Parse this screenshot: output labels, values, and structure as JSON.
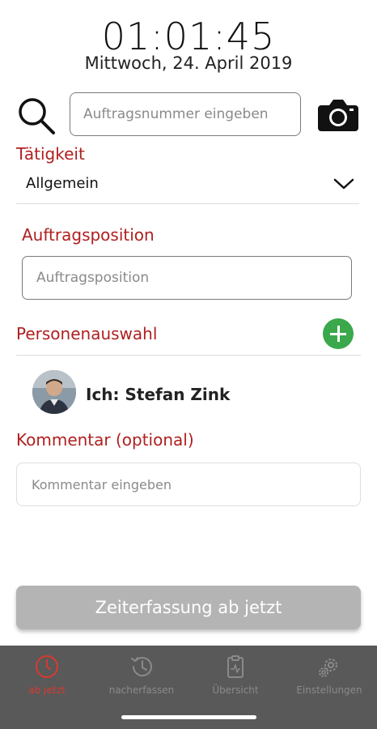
{
  "header": {
    "time": "01:01:45",
    "date": "Mittwoch, 24. April 2019"
  },
  "search": {
    "placeholder": "Auftragsnummer eingeben",
    "search_icon": "search-icon",
    "camera_icon": "camera-icon"
  },
  "activity": {
    "label": "Tätigkeit",
    "selected": "Allgemein",
    "chevron_icon": "chevron-down-icon"
  },
  "position": {
    "label": "Auftragsposition",
    "placeholder": "Auftragsposition"
  },
  "persons": {
    "label": "Personenauswahl",
    "add_icon": "plus-icon",
    "people": [
      {
        "name": "Ich: Stefan Zink"
      }
    ]
  },
  "comment": {
    "label": "Kommentar (optional)",
    "placeholder": "Kommentar eingeben"
  },
  "primary_button": {
    "label": "Zeiterfassung ab jetzt"
  },
  "tabs": [
    {
      "label": "ab jetzt",
      "icon": "clock-icon",
      "active": true
    },
    {
      "label": "nacherfassen",
      "icon": "history-icon",
      "active": false
    },
    {
      "label": "Übersicht",
      "icon": "clipboard-icon",
      "active": false
    },
    {
      "label": "Einstellungen",
      "icon": "gear-icon",
      "active": false
    }
  ],
  "colors": {
    "accent_red": "#b01f1f",
    "add_green": "#3aa84b",
    "tab_active": "#d93a2e",
    "tabbar_bg": "#595959",
    "button_disabled": "#b4b4b4"
  }
}
